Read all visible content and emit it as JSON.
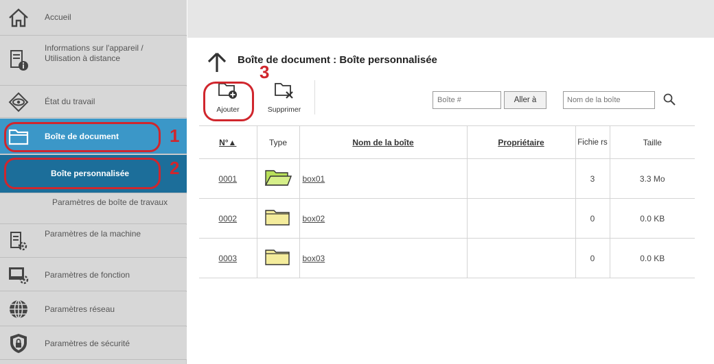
{
  "sidebar": {
    "items": [
      {
        "label": "Accueil",
        "icon": "home-icon"
      },
      {
        "label": "Informations sur l'appareil / Utilisation à distance",
        "icon": "device-info-icon"
      },
      {
        "label": "État du travail",
        "icon": "eye-icon"
      },
      {
        "label": "Boîte de document",
        "icon": "folder-icon"
      },
      {
        "label": "Boîte personnalisée"
      },
      {
        "label": "Paramètres de boîte de travaux"
      },
      {
        "label": "Paramètres de la machine",
        "icon": "machine-settings-icon"
      },
      {
        "label": "Paramètres de fonction",
        "icon": "function-settings-icon"
      },
      {
        "label": "Paramètres réseau",
        "icon": "globe-icon"
      },
      {
        "label": "Paramètres de sécurité",
        "icon": "shield-icon"
      }
    ]
  },
  "callouts": {
    "one": "1",
    "two": "2",
    "three": "3"
  },
  "main": {
    "title": "Boîte de document : Boîte personnalisée",
    "toolbar": {
      "add_label": "Ajouter",
      "delete_label": "Supprimer",
      "box_number_placeholder": "Boîte #",
      "goto_label": "Aller à",
      "box_name_placeholder": "Nom de la boîte"
    },
    "table": {
      "headers": {
        "number": "N°▲",
        "type": "Type",
        "name": "Nom de la boîte",
        "owner": "Propriétaire",
        "files": "Fichie rs",
        "size": "Taille"
      },
      "rows": [
        {
          "number": "0001",
          "name": "box01",
          "owner": "",
          "files": "3",
          "size": "3.3 Mo",
          "folder_color": "#b8e05a"
        },
        {
          "number": "0002",
          "name": "box02",
          "owner": "",
          "files": "0",
          "size": "0.0 KB",
          "folder_color": "#f4ec9c"
        },
        {
          "number": "0003",
          "name": "box03",
          "owner": "",
          "files": "0",
          "size": "0.0 KB",
          "folder_color": "#f4ec9c"
        }
      ]
    }
  },
  "colors": {
    "sidebar_bg": "#d7d7d7",
    "active_item": "#3b97c8",
    "active_subitem": "#1c6e9a",
    "callout_red": "#d0262d"
  }
}
